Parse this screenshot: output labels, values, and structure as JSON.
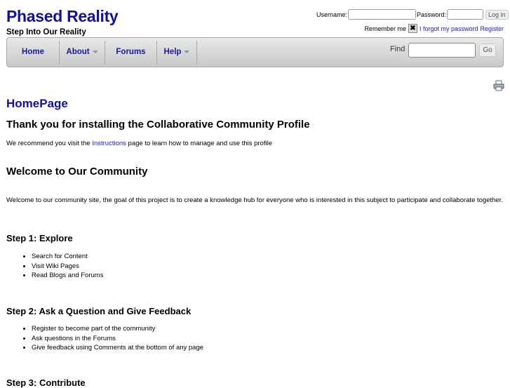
{
  "header": {
    "title": "Phased Reality",
    "tagline": "Step Into Our Reality"
  },
  "login": {
    "username_label": "Username:",
    "username_value": "",
    "password_label": "Password:",
    "password_value": "",
    "login_button": "Log in",
    "remember_label": "Remember me",
    "forgot_link": "I forgot my password",
    "register_link": "Register"
  },
  "nav": {
    "items": [
      {
        "label": "Home"
      },
      {
        "label": "About"
      },
      {
        "label": "Forums"
      },
      {
        "label": "Help"
      }
    ],
    "find_label": "Find",
    "find_value": "",
    "go_button": "Go"
  },
  "page": {
    "title": "HomePage",
    "intro_heading": "Thank you for installing the Collaborative Community Profile",
    "intro_before": "We recommend you visit the ",
    "intro_link": "Instructions",
    "intro_after": " page to learn how to manage and use this profile",
    "welcome_heading": "Welcome to Our Community",
    "welcome_text": "Welcome to our community site, the goal of this project is to create a knowledge hub for everyone who is interested in this subject to participate and collaborate together.",
    "steps": [
      {
        "heading": "Step 1: Explore",
        "items": [
          "Search for Content",
          "Visit Wiki Pages",
          "Read Blogs and Forums"
        ]
      },
      {
        "heading": "Step 2: Ask a Question and Give Feedback",
        "items": [
          "Register to become part of the community",
          "Ask questions in the Forums",
          "Give feedback using Comments at the bottom of any page"
        ]
      },
      {
        "heading": "Step 3: Contribute"
      }
    ]
  }
}
